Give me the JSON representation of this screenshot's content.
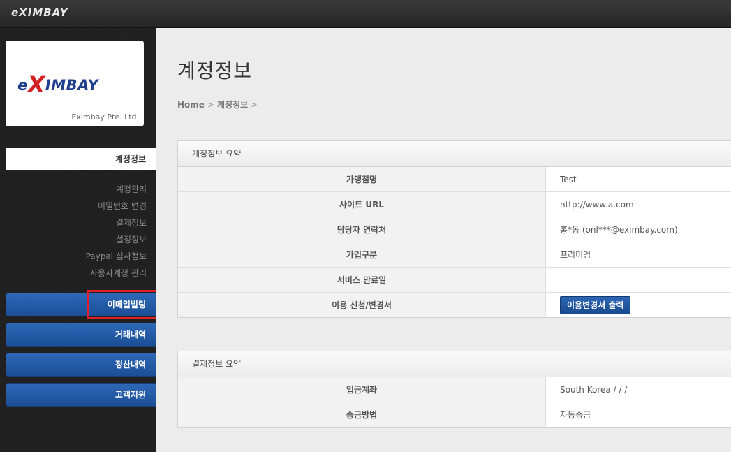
{
  "topbar": {
    "brand": "eXIMBAY"
  },
  "sidebar": {
    "logo_prefix": "e",
    "logo_x": "X",
    "logo_suffix": "IMBAY",
    "company": "Eximbay Pte. Ltd.",
    "active_section": "계정정보",
    "sub_items": [
      "계정관리",
      "비밀번호 변경",
      "결제정보",
      "설정정보",
      "Paypal 심사정보",
      "사용자계정 관리"
    ],
    "main_items": [
      "이메일빌링",
      "거래내역",
      "정산내역",
      "고객지원"
    ]
  },
  "main": {
    "title": "계정정보",
    "breadcrumb": [
      "Home",
      "계정정보"
    ],
    "breadcrumb_sep": ">",
    "account_panel": {
      "title": "계정정보 요약",
      "rows": [
        {
          "label": "가맹점명",
          "value": "Test"
        },
        {
          "label": "사이트 URL",
          "value": "http://www.a.com"
        },
        {
          "label": "담당자 연락처",
          "value": "홍*동 (onl***@eximbay.com)"
        },
        {
          "label": "가입구분",
          "value": "프리미엄"
        },
        {
          "label": "서비스 만료일",
          "value": ""
        },
        {
          "label": "이용 신청/변경서",
          "button": "이용변경서 출력"
        }
      ]
    },
    "payment_panel": {
      "title": "결제정보 요약",
      "rows": [
        {
          "label": "입금계좌",
          "value": "South Korea / / /"
        },
        {
          "label": "송금방법",
          "value": "자동송금"
        }
      ]
    }
  },
  "colors": {
    "accent_blue": "#1f55a0",
    "highlight_red": "#e0212b",
    "logo_blue": "#1f3e8c",
    "logo_red": "#d32020"
  }
}
